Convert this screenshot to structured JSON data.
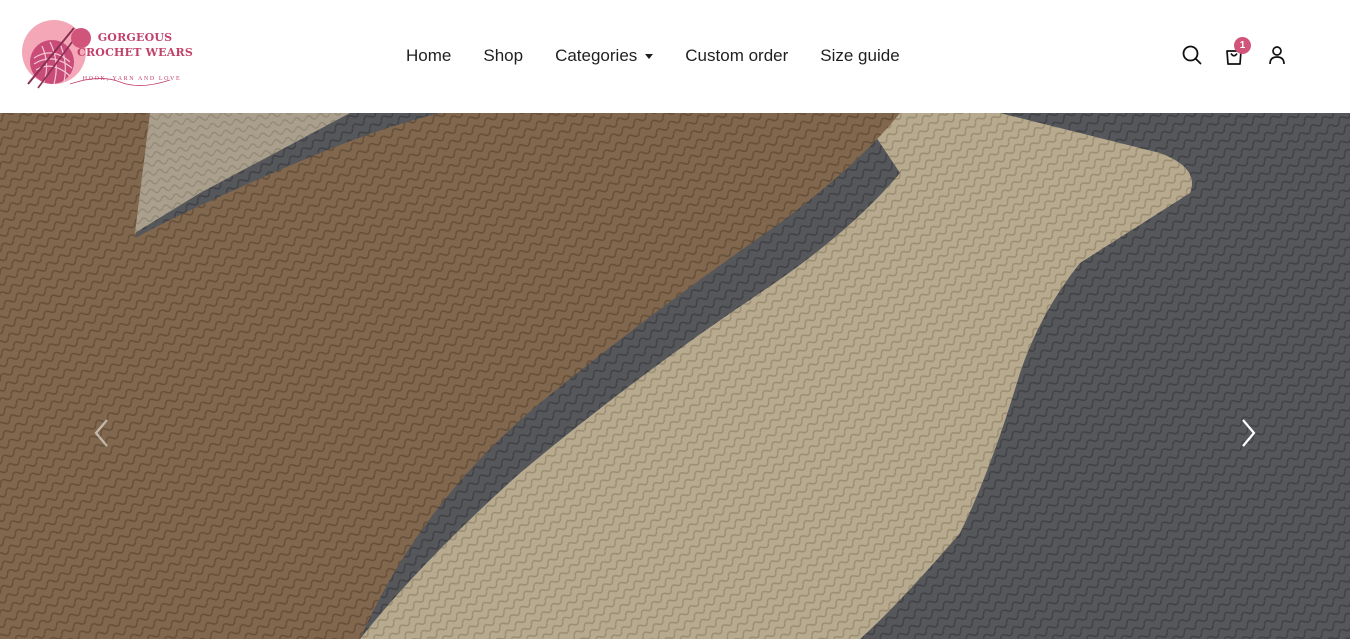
{
  "brand": {
    "name_line1": "GORGEOUS",
    "name_line2": "CROCHET WEARS",
    "tagline": "HOOK, YARN AND LOVE",
    "accent_color": "#d1547b",
    "logo_icon": "yarn-ball-icon"
  },
  "nav": {
    "items": [
      {
        "label": "Home"
      },
      {
        "label": "Shop"
      },
      {
        "label": "Categories",
        "has_dropdown": true
      },
      {
        "label": "Custom order"
      },
      {
        "label": "Size guide"
      }
    ]
  },
  "header_icons": {
    "search": "search-icon",
    "cart": "shopping-bag-icon",
    "cart_count": "1",
    "account": "user-icon"
  },
  "hero": {
    "image": "knitted sweaters in beige, cream and grey",
    "prev_icon": "chevron-left-icon",
    "next_icon": "chevron-right-icon"
  }
}
